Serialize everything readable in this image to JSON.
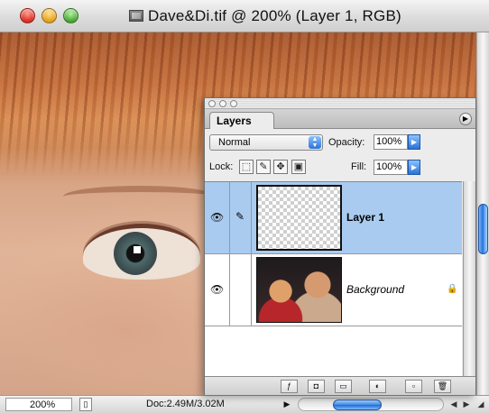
{
  "window": {
    "title": "Dave&Di.tif @ 200% (Layer 1, RGB)"
  },
  "status_bar": {
    "zoom": "200%",
    "doc_size": "Doc:2.49M/3.02M"
  },
  "layers_palette": {
    "tab_label": "Layers",
    "blend_mode": "Normal",
    "opacity_label": "Opacity:",
    "opacity_value": "100%",
    "lock_label": "Lock:",
    "fill_label": "Fill:",
    "fill_value": "100%",
    "layers": [
      {
        "name": "Layer 1",
        "selected": true,
        "visible": true
      },
      {
        "name": "Background",
        "selected": false,
        "visible": true,
        "locked": true
      }
    ],
    "selection_color": "#a9cbef"
  },
  "colors": {
    "accent_blue": "#2a72d8"
  }
}
